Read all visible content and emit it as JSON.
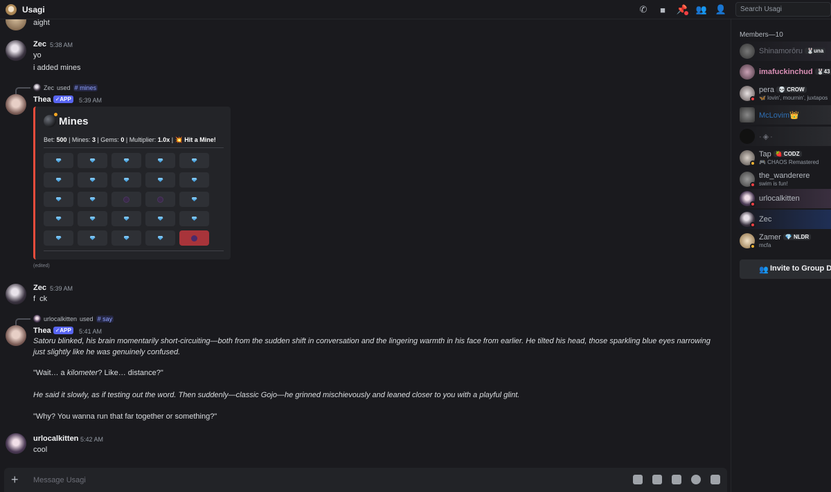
{
  "header": {
    "channel_name": "Usagi",
    "search_placeholder": "Search Usagi",
    "icons": [
      "call-icon",
      "video-icon",
      "pin-icon",
      "add-member-icon",
      "members-icon"
    ]
  },
  "messages": {
    "m0": {
      "text": "aight"
    },
    "m1": {
      "author": "Zec",
      "time": "5:38 AM",
      "lines": [
        "yo",
        "i added mines"
      ]
    },
    "m2": {
      "used_by": "Zec",
      "used_word": "used",
      "command": "mines",
      "author": "Thea",
      "badge": "✓APP",
      "time": "5:39 AM",
      "embed": {
        "title": "Mines",
        "bet_label": "Bet:",
        "bet": "500",
        "mines_label": "Mines:",
        "mines": "3",
        "gems_label": "Gems:",
        "gems": "0",
        "multiplier_label": "Multiplier:",
        "multiplier": "1.0x",
        "result": "💥 Hit a Mine!",
        "grid": [
          [
            "gem",
            "gem",
            "gem",
            "gem",
            "gem"
          ],
          [
            "gem",
            "gem",
            "gem",
            "gem",
            "gem"
          ],
          [
            "gem",
            "gem",
            "mine",
            "mine",
            "gem"
          ],
          [
            "gem",
            "gem",
            "gem",
            "gem",
            "gem"
          ],
          [
            "gem",
            "gem",
            "gem",
            "gem",
            "hit"
          ]
        ]
      },
      "edited": "(edited)"
    },
    "m3": {
      "author": "Zec",
      "time": "5:39 AM",
      "text": "f  ck"
    },
    "m4": {
      "used_by": "urlocalkitten",
      "used_word": "used",
      "command": "say",
      "author": "Thea",
      "badge": "✓APP",
      "time": "5:41 AM",
      "p1": "Satoru blinked, his brain momentarily short-circuiting—both from the sudden shift in conversation and the lingering warmth in his face from earlier. He tilted his head, those sparkling blue eyes narrowing",
      "p1b": "just slightly like he was genuinely confused.",
      "p2a": "\"Wait… a ",
      "p2em": "kilometer",
      "p2b": "? Like… distance?\"",
      "p3": "He said it slowly, as if testing out the word. Then suddenly—classic Gojo—he grinned mischievously and leaned closer to you with a playful glint.",
      "p4": "\"Why? You wanna run that far together or something?\""
    },
    "m5": {
      "author": "urlocalkitten",
      "time": "5:42 AM",
      "text": "cool"
    }
  },
  "composer": {
    "placeholder": "Message Usagi"
  },
  "members": {
    "heading": "Members—10",
    "list": [
      {
        "name": "Shinamorōru",
        "tag": "🐰una",
        "status": "",
        "color": "#6d6f78"
      },
      {
        "name": "imafuckinchud",
        "tag": "🐰43",
        "status": "",
        "color": "#d98fb5"
      },
      {
        "name": "pera",
        "tag": "💀 CROW",
        "status": "🦋 lovin', mournin', juxtapos",
        "color": "#b5bac1"
      },
      {
        "name": "McLovim",
        "tag": "👑",
        "status": "",
        "color": "#2f6fb3"
      },
      {
        "name": "",
        "tag": "",
        "status": "",
        "color": "#b5bac1"
      },
      {
        "name": "Tap",
        "tag": "🍓 CODZ",
        "status": "🎮 CHAOS Remastered",
        "color": "#b5bac1"
      },
      {
        "name": "the_wanderere",
        "tag": "",
        "status": "swim is fun!",
        "color": "#b5bac1"
      },
      {
        "name": "urlocalkitten",
        "tag": "",
        "status": "",
        "color": "#b5bac1"
      },
      {
        "name": "Zec",
        "tag": "",
        "status": "",
        "color": "#b5bac1"
      },
      {
        "name": "Zamer",
        "tag": "💎 NLDR",
        "status": "mcfa",
        "color": "#b5bac1"
      }
    ],
    "invite_label": "Invite to Group DM"
  }
}
